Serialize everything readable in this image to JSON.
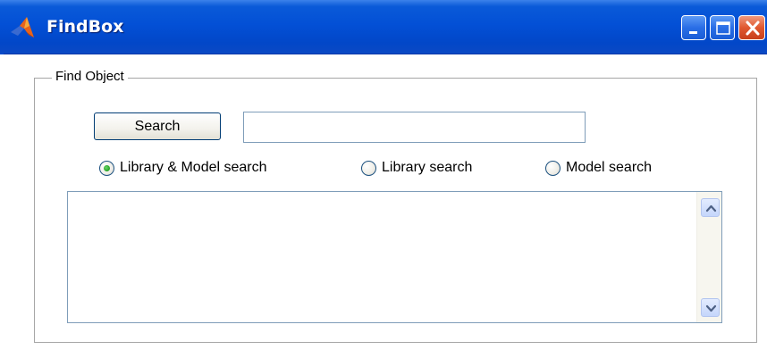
{
  "window": {
    "title": "FindBox",
    "icon": "matlab-logo-icon",
    "buttons": [
      "minimize",
      "maximize",
      "close"
    ]
  },
  "group": {
    "legend": "Find Object"
  },
  "search": {
    "button_label": "Search",
    "input_value": "",
    "input_placeholder": ""
  },
  "scope": {
    "options": [
      {
        "label": "Library & Model search",
        "selected": true
      },
      {
        "label": "Library search",
        "selected": false
      },
      {
        "label": "Model search",
        "selected": false
      }
    ]
  },
  "results": {
    "items": []
  },
  "colors": {
    "titlebar": "#0350d6",
    "close_button": "#e0582f",
    "radio_selected": "#21a121"
  }
}
